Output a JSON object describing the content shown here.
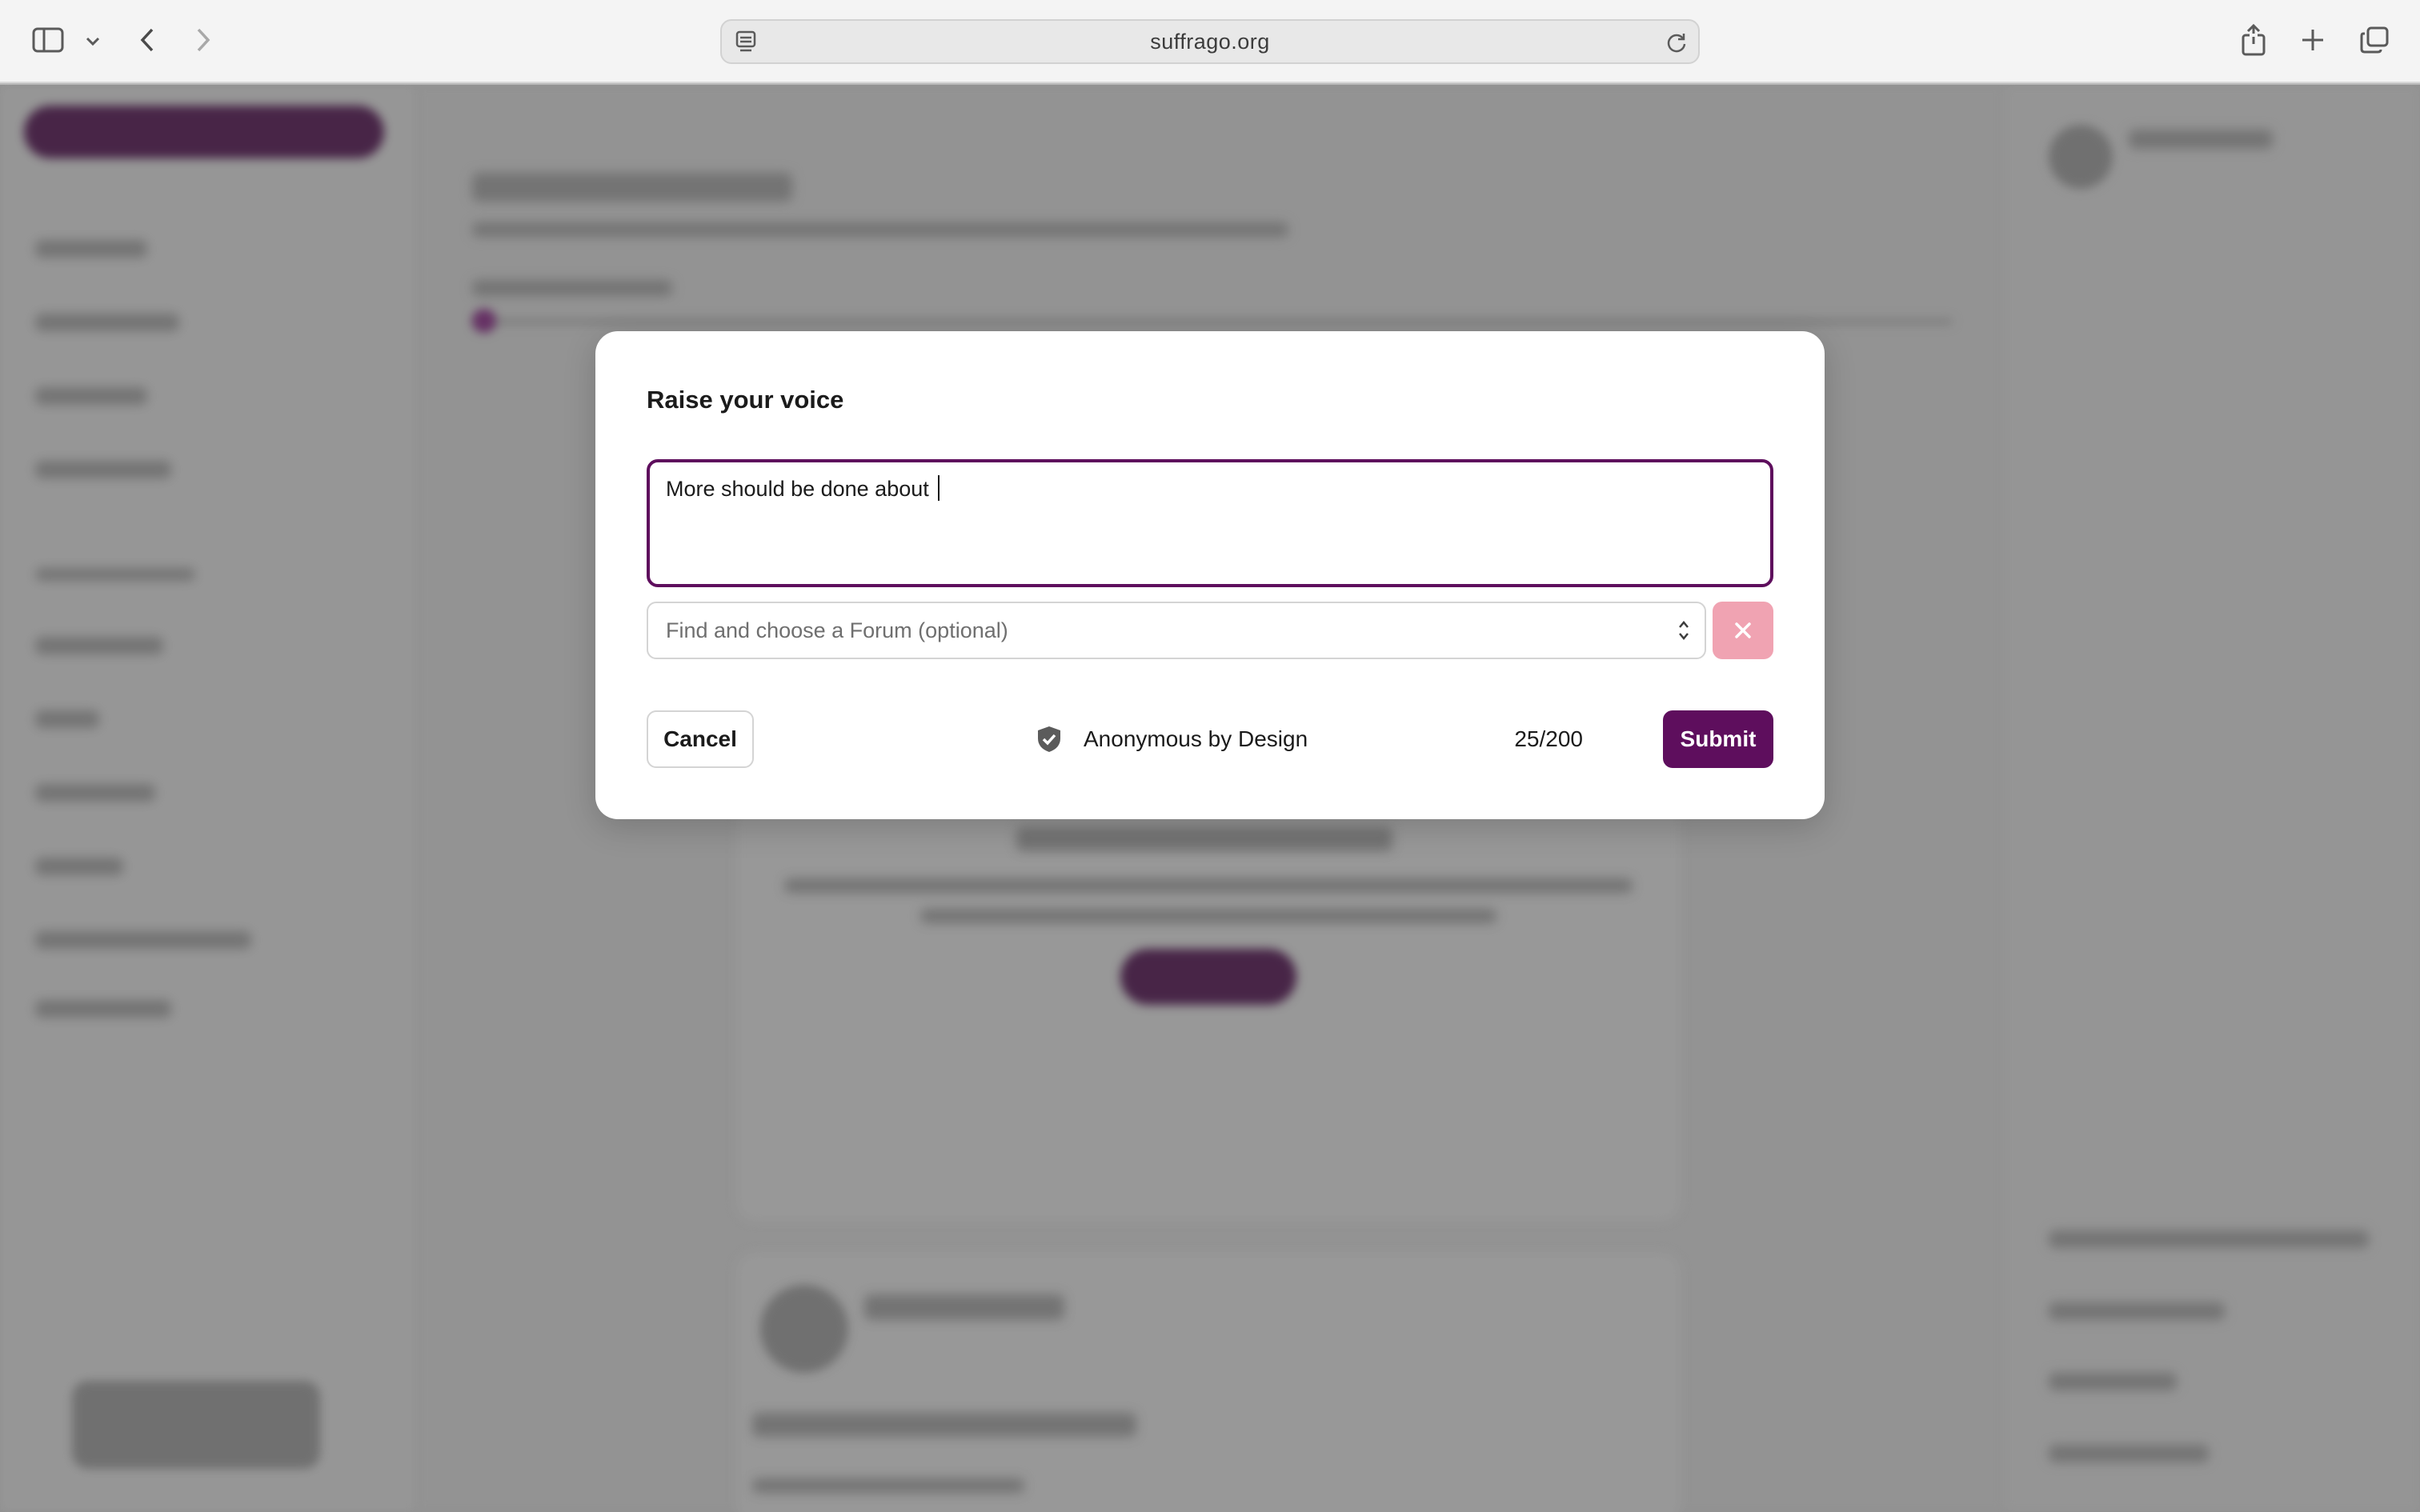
{
  "browser": {
    "url": "suffrago.org",
    "icons": {
      "sidebar": "sidebar-icon",
      "chevron": "chevron-down-icon",
      "back": "back-icon",
      "forward": "forward-icon",
      "page": "page-icon",
      "reload": "reload-icon",
      "share": "share-icon",
      "new_tab": "plus-icon",
      "tabs": "tabs-overview-icon"
    }
  },
  "modal": {
    "title": "Raise your voice",
    "textarea_value": "More should be done about ",
    "forum_placeholder": "Find and choose a Forum (optional)",
    "cancel_label": "Cancel",
    "anonymous_label": "Anonymous by Design",
    "char_count": "25/200",
    "submit_label": "Submit"
  },
  "colors": {
    "accent": "#5e0e5d",
    "clear_button": "#f0a3b2",
    "overlay": "#b9b9b9"
  }
}
